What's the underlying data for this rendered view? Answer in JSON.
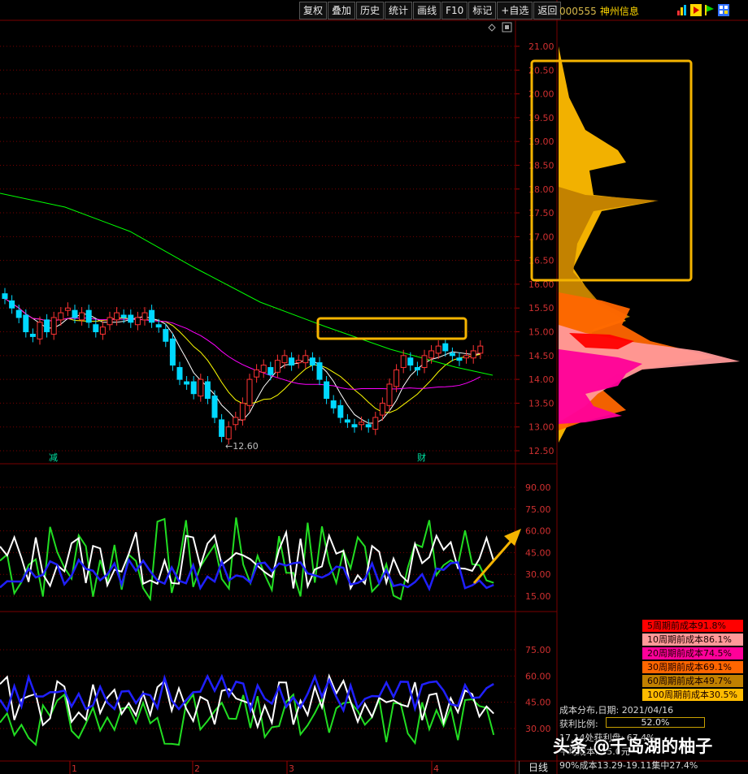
{
  "toolbar": {
    "buttons": [
      "复权",
      "叠加",
      "历史",
      "统计",
      "画线",
      "F10",
      "标记",
      "+自选",
      "返回"
    ]
  },
  "stock": {
    "code": "000555",
    "name": "神州信息"
  },
  "price_axis": [
    "21.00",
    "20.50",
    "20.00",
    "19.50",
    "19.00",
    "18.50",
    "18.00",
    "17.50",
    "17.00",
    "16.50",
    "16.00",
    "15.50",
    "15.00",
    "14.50",
    "14.00",
    "13.50",
    "13.00",
    "12.50"
  ],
  "ind1_axis": [
    "90.00",
    "75.00",
    "60.00",
    "45.00",
    "30.00",
    "15.00"
  ],
  "ind2_axis": [
    "75.00",
    "60.00",
    "45.00",
    "30.00"
  ],
  "x_axis": [
    "1",
    "2",
    "3",
    "4"
  ],
  "marks": {
    "low_label": "12.60",
    "event1": "减",
    "event2": "财"
  },
  "legend": [
    {
      "text": "5周期前成本91.8%",
      "color": "#ff0000"
    },
    {
      "text": "10周期前成本86.1%",
      "color": "#ff9999"
    },
    {
      "text": "20周期前成本74.5%",
      "color": "#ff0099"
    },
    {
      "text": "30周期前成本69.1%",
      "color": "#ff6600"
    },
    {
      "text": "60周期前成本49.7%",
      "color": "#c08000"
    },
    {
      "text": "100周期前成本30.5%",
      "color": "#ffbb00"
    }
  ],
  "info": {
    "date_line": "成本分布,日期:  2021/04/16",
    "profit_label": "获利比例:",
    "profit_ratio": "52.0%",
    "profit_fraction": 0.52,
    "line3": "17.14处获利盘:  67.4%",
    "line4": "平均成本: 15.0元",
    "line5": "90%成本13.29-19.11集中27.4%"
  },
  "watermark": "头条 @千岛湖的柚子",
  "period": "日线",
  "colors": {
    "up": "#ff3333",
    "down": "#00d8ff",
    "ma5": "#ffffff",
    "ma10": "#ffff00",
    "ma20": "#ff00ff",
    "ma60": "#00ff00",
    "highlight": "#f5b400"
  }
}
